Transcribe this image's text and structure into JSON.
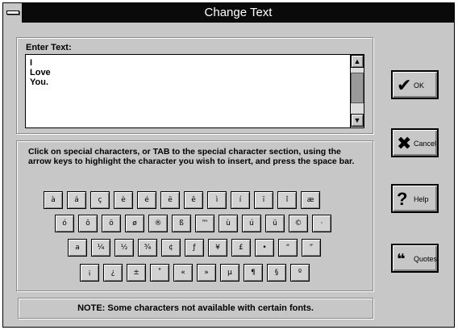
{
  "window": {
    "title": "Change Text"
  },
  "enter_text": {
    "label": "Enter Text:",
    "lines": [
      "I",
      "Love",
      "You."
    ]
  },
  "scroll": {
    "up_icon": "arrow-up-icon",
    "down_icon": "arrow-down-icon"
  },
  "instructions": "Click on special characters, or TAB to the special character section, using the arrow keys to highlight the character you wish to insert, and press the space bar.",
  "keyboard": {
    "rows": [
      [
        "à",
        "á",
        "ç",
        "è",
        "é",
        "ë",
        "ê",
        "ì",
        "í",
        "ï",
        "î",
        "æ"
      ],
      [
        "ó",
        "ô",
        "ö",
        "ø",
        "®",
        "ß",
        "™",
        "ù",
        "ú",
        "ü",
        "©",
        "·"
      ],
      [
        "a",
        "¼",
        "½",
        "¾",
        "¢",
        "ƒ",
        "¥",
        "£",
        "•",
        "“",
        "”"
      ],
      [
        "¡",
        "¿",
        "±",
        "˚",
        "«",
        "»",
        "µ",
        "¶",
        "§",
        "º"
      ]
    ]
  },
  "note": "NOTE: Some characters not available with certain fonts.",
  "buttons": {
    "ok": {
      "label": "OK",
      "icon": "checkmark-icon"
    },
    "cancel": {
      "label": "Cancel",
      "icon": "x-icon"
    },
    "help": {
      "label": "Help",
      "icon": "question-mark-icon"
    },
    "quotes": {
      "label": "Quotes",
      "icon": "quote-marks-icon"
    }
  }
}
